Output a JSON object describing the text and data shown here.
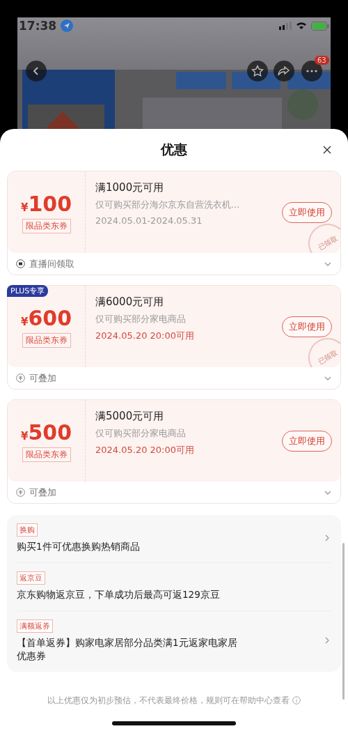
{
  "status_bar": {
    "time": "17:38"
  },
  "header": {
    "more_badge": "63"
  },
  "sheet": {
    "title": "优惠"
  },
  "coupons": [
    {
      "currency": "¥",
      "amount": "100",
      "tag": "限品类东券",
      "title": "满1000元可用",
      "desc": "仅可购买部分海尔京东自营洗衣机...",
      "date": "2024.05.01-2024.05.31",
      "date_highlight": false,
      "button": "立即使用",
      "stamp": "已领取",
      "footer": {
        "kind": "live",
        "text": "直播间领取"
      }
    },
    {
      "badge": "PLUS专享",
      "currency": "¥",
      "amount": "600",
      "tag": "限品类东券",
      "title": "满6000元可用",
      "desc": "仅可购买部分家电商品",
      "date": "2024.05.20 20:00可用",
      "date_highlight": true,
      "button": "立即使用",
      "stamp": "已领取",
      "footer": {
        "kind": "stack",
        "text": "可叠加"
      }
    },
    {
      "currency": "¥",
      "amount": "500",
      "tag": "限品类东券",
      "title": "满5000元可用",
      "desc": "仅可购买部分家电商品",
      "date": "2024.05.20 20:00可用",
      "date_highlight": true,
      "button": "立即使用",
      "footer": {
        "kind": "stack",
        "text": "可叠加"
      }
    }
  ],
  "promotions": [
    {
      "tag": "换购",
      "text": "购买1件可优惠换购热销商品",
      "has_arrow": true
    },
    {
      "tag": "返京豆",
      "text": "京东购物返京豆，下单成功后最高可返129京豆",
      "has_arrow": false
    },
    {
      "tag": "满额返券",
      "text": "【首单返券】购家电家居部分品类满1元返家电家居优惠券",
      "has_arrow": true
    }
  ],
  "footer_note": "以上优惠仅为初步预估，不代表最终价格，规则可在帮助中心查看"
}
